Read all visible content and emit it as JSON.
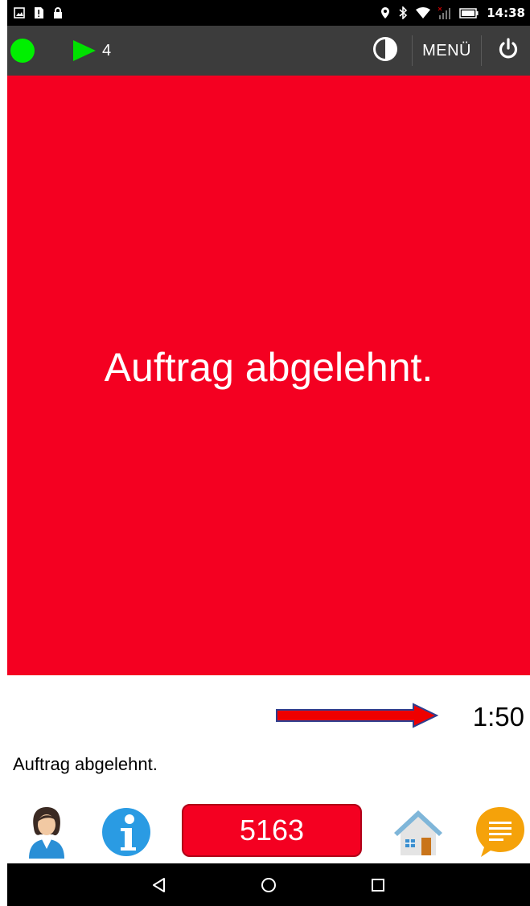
{
  "status_bar": {
    "time": "14:38",
    "left_icons": [
      "image-icon",
      "alert-icon",
      "lock-icon"
    ],
    "right_icons": [
      "location-icon",
      "bluetooth-icon",
      "wifi-icon",
      "signal-icon",
      "battery-icon"
    ]
  },
  "toolbar": {
    "status_color": "#00f000",
    "play_count": "4",
    "menu_label": "MENÜ",
    "icons": [
      "online-status-icon",
      "play-icon",
      "contrast-icon",
      "power-icon"
    ]
  },
  "main": {
    "message": "Auftrag abgelehnt.",
    "background_color": "#f40021"
  },
  "timer": {
    "value": "1:50"
  },
  "status_text": "Auftrag abgelehnt.",
  "bottom_bar": {
    "order_number": "5163",
    "icons": [
      "driver-profile-icon",
      "info-icon",
      "home-icon",
      "messages-icon"
    ]
  },
  "nav_bar": {
    "icons": [
      "back-icon",
      "home-circle-icon",
      "recents-icon"
    ]
  }
}
